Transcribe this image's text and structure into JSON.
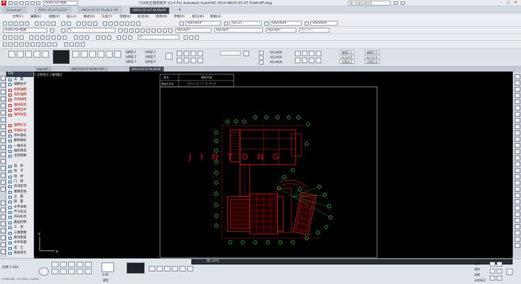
{
  "app": {
    "title": "T20天正建筑软件 V1.0 For Autodesk AutoCAD 2014    ARCH-05-07-PLAN-RF.dwg",
    "workspace": "AutoCAD 经典",
    "search_placeholder": "键入关键字或短语",
    "window_buttons": [
      "–",
      "□",
      "✕"
    ]
  },
  "doc_tabs": [
    {
      "label": "Drawing1*",
      "active": false
    },
    {
      "label": "ARCH-05-07-ELEV*",
      "active": false
    },
    {
      "label": "ARCH-05-07-PLAN-1-RP",
      "active": false
    },
    {
      "label": "ARCH-05-07-PLAN-RF",
      "active": true
    }
  ],
  "menu": [
    "文件(F)",
    "编辑(E)",
    "视图(V)",
    "插入(I)",
    "格式(O)",
    "工具(T)",
    "绘图(D)",
    "标注(N)",
    "修改(M)",
    "参数(P)",
    "窗口(W)",
    "帮助(H)"
  ],
  "toolbar1": {
    "workspace": "AutoCAD 经典",
    "text_style": "Standard",
    "dim_style": "ISO-25",
    "table_style": "Standard",
    "mleader_style": "Standard"
  },
  "toolbar2": {
    "layer": "0",
    "color": "ByLayer",
    "linetype": "ByLayer",
    "lineweight": "ByLayer",
    "plotstyle": "ByColor"
  },
  "ribbon": {
    "layer_rows": [
      "当前层 1",
      "当前层 2",
      "当前层 3"
    ],
    "layer_rows_b": [
      "当前层 4",
      "当前层 5",
      "当前层 6"
    ],
    "xlayers": [
      "XFLAYER",
      "XFLAYER",
      "XFLAYER"
    ],
    "right_buttons": [
      "编辑尺寸",
      "标注文字",
      "详图标注"
    ],
    "right_buttons_b": [
      "编辑尺寸",
      "标注文字",
      "详图标注"
    ]
  },
  "drawing_tabs": [
    {
      "label": "Layout1",
      "active": false
    },
    {
      "label": "ARCH-05-07-PLAN-1-RP",
      "active": false
    },
    {
      "label": "ARCH-05-07-PLAN-RF",
      "active": true
    }
  ],
  "viewport_label": "[-][俯视][二维线框]",
  "palette": {
    "header": "T20",
    "items": [
      {
        "label": "设　置",
        "red": false
      },
      {
        "label": "轴网柱子",
        "red": false
      },
      {
        "label": "绘制轴网",
        "red": true
      },
      {
        "label": "墙生轴网",
        "red": true
      },
      {
        "label": "添加轴线",
        "red": true
      },
      {
        "label": "轴线裁剪",
        "red": true
      },
      {
        "label": "轴网合并",
        "red": true
      },
      {
        "label": "轴改线型",
        "red": true
      },
      {
        "label": "",
        "red": false
      },
      {
        "label": "轴网标注",
        "red": true
      },
      {
        "label": "单轴标注",
        "red": true
      },
      {
        "label": "添补轴号",
        "red": false
      },
      {
        "label": "删除轴号",
        "red": false
      },
      {
        "label": "一轴多号",
        "red": false
      },
      {
        "label": "轴号隐现",
        "red": false
      },
      {
        "label": "主附转换",
        "red": false
      },
      {
        "label": "",
        "red": false
      },
      {
        "label": "墙　体",
        "red": false
      },
      {
        "label": "柱　子",
        "red": false
      },
      {
        "label": "墙　体",
        "red": false
      },
      {
        "label": "门　窗",
        "red": false
      },
      {
        "label": "房间屋顶",
        "red": false
      },
      {
        "label": "楼梯其他",
        "red": false
      },
      {
        "label": "立　面",
        "red": false
      },
      {
        "label": "剖　面",
        "red": false
      },
      {
        "label": "文字表格",
        "red": false
      },
      {
        "label": "尺寸标注",
        "red": false
      },
      {
        "label": "符号标注",
        "red": false
      },
      {
        "label": "图层控制",
        "red": false
      },
      {
        "label": "工　具",
        "red": false
      },
      {
        "label": "三维建模",
        "red": false
      },
      {
        "label": "图块图案",
        "red": false
      },
      {
        "label": "文件布图",
        "red": false
      },
      {
        "label": "其　它",
        "red": false
      },
      {
        "label": "帮助演示",
        "red": false
      }
    ]
  },
  "drawing": {
    "title_block": {
      "col1": "图名",
      "col2": "建筑平面",
      "row2_label": "图纸文件名",
      "row2_value": "ARCH-05-07-PLAN-RF"
    },
    "watermark": "J I N T O N G",
    "axis_y": "Y",
    "axis_x": "X"
  },
  "command": {
    "prompt": "键入命令"
  },
  "status": {
    "scale": "比例 1:100",
    "coords": "17000.200, 107.2021, 0.0000",
    "model": "模型",
    "view_number": "0.00",
    "right_labels": [
      "基线",
      "填充",
      "加粗",
      "动态标注"
    ]
  },
  "colors": {
    "canvas": "#000000",
    "plan_red": "#ff2a2a",
    "axis_green": "#33dd44",
    "watermark": "#7a1020"
  }
}
